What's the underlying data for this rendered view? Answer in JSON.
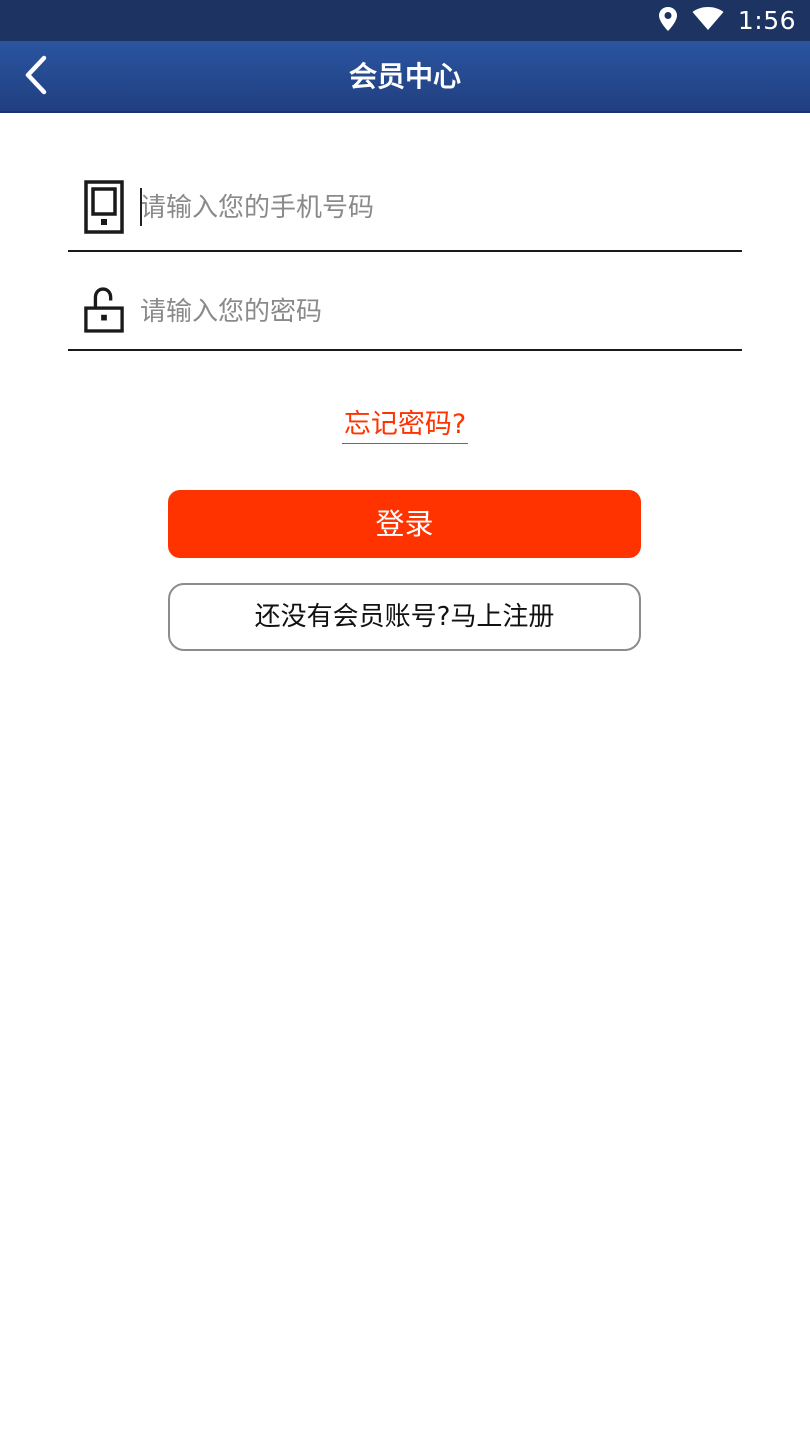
{
  "status_bar": {
    "time": "1:56",
    "icons": [
      "location-icon",
      "wifi-icon"
    ]
  },
  "app_bar": {
    "title": "会员中心",
    "back_icon": "chevron-left-icon"
  },
  "login_form": {
    "phone": {
      "icon": "mobile-phone-icon",
      "placeholder": "请输入您的手机号码",
      "value": ""
    },
    "password": {
      "icon": "unlocked-padlock-icon",
      "placeholder": "请输入您的密码",
      "value": ""
    },
    "forgot_password_label": "忘记密码?",
    "login_label": "登录",
    "register_label": "还没有会员账号?马上注册"
  },
  "colors": {
    "status_bar_bg": "#1d3361",
    "app_bar_bg": "#2a55a0",
    "accent": "#ff3300",
    "text": "#111111",
    "placeholder": "#8a8a8a"
  }
}
